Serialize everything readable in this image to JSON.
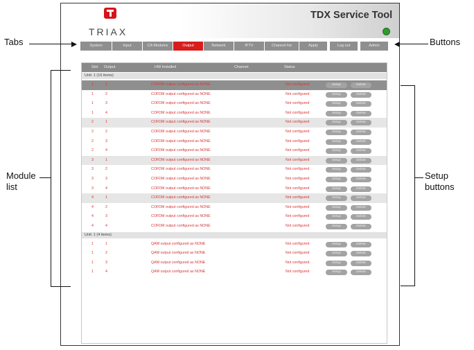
{
  "app": {
    "logo_text": "TRIAX",
    "title": "TDX Service Tool"
  },
  "tabs": [
    "System",
    "Input",
    "CA Modules",
    "Output",
    "Network",
    "IPTV",
    "Channel list"
  ],
  "active_tab": "Output",
  "buttons": [
    "Apply",
    "Log out",
    "Admin"
  ],
  "table": {
    "headers": {
      "slot": "Slot",
      "output": "Output",
      "hw": "HW Installed",
      "channel": "Channel",
      "status": "Status"
    },
    "groups": [
      {
        "label": "Unit: 1 (16 items)"
      },
      {
        "label": "Unit: 1 (4 items)"
      }
    ],
    "rows_unit1": [
      {
        "slot": "1",
        "output": "1",
        "hw": "COFDM output configured as NONE",
        "status": "Not configured"
      },
      {
        "slot": "1",
        "output": "2",
        "hw": "COFDM output configured as NONE",
        "status": "Not configured"
      },
      {
        "slot": "1",
        "output": "3",
        "hw": "COFDM output configured as NONE",
        "status": "Not configured"
      },
      {
        "slot": "1",
        "output": "4",
        "hw": "COFDM output configured as NONE",
        "status": "Not configured"
      },
      {
        "slot": "2",
        "output": "1",
        "hw": "COFDM output configured as NONE",
        "status": "Not configured"
      },
      {
        "slot": "2",
        "output": "2",
        "hw": "COFDM output configured as NONE",
        "status": "Not configured"
      },
      {
        "slot": "2",
        "output": "3",
        "hw": "COFDM output configured as NONE",
        "status": "Not configured"
      },
      {
        "slot": "2",
        "output": "4",
        "hw": "COFDM output configured as NONE",
        "status": "Not configured"
      },
      {
        "slot": "3",
        "output": "1",
        "hw": "COFDM output configured as NONE",
        "status": "Not configured"
      },
      {
        "slot": "3",
        "output": "2",
        "hw": "COFDM output configured as NONE",
        "status": "Not configured"
      },
      {
        "slot": "3",
        "output": "3",
        "hw": "COFDM output configured as NONE",
        "status": "Not configured"
      },
      {
        "slot": "3",
        "output": "4",
        "hw": "COFDM output configured as NONE",
        "status": "Not configured"
      },
      {
        "slot": "4",
        "output": "1",
        "hw": "COFDM output configured as NONE",
        "status": "Not configured"
      },
      {
        "slot": "4",
        "output": "2",
        "hw": "COFDM output configured as NONE",
        "status": "Not configured"
      },
      {
        "slot": "4",
        "output": "3",
        "hw": "COFDM output configured as NONE",
        "status": "Not configured"
      },
      {
        "slot": "4",
        "output": "4",
        "hw": "COFDM output configured as NONE",
        "status": "Not configured"
      }
    ],
    "rows_unit2": [
      {
        "slot": "1",
        "output": "1",
        "hw": "QAM output configured as NONE",
        "status": "Not configured"
      },
      {
        "slot": "1",
        "output": "2",
        "hw": "QAM output configured as NONE",
        "status": "Not configured"
      },
      {
        "slot": "1",
        "output": "3",
        "hw": "QAM output configured as NONE",
        "status": "Not configured"
      },
      {
        "slot": "1",
        "output": "4",
        "hw": "QAM output configured as NONE",
        "status": "Not configured"
      }
    ],
    "setup_label": "Setup",
    "delete_label": "Delete"
  },
  "annotations": {
    "tabs": "Tabs",
    "buttons": "Buttons",
    "module_list_1": "Module",
    "module_list_2": "list",
    "setup_buttons_1": "Setup",
    "setup_buttons_2": "buttons"
  },
  "colors": {
    "active_tab": "#d91c1c",
    "row_text": "#d63636",
    "status_led": "#2f9a2f",
    "logo": "#d4151c"
  }
}
